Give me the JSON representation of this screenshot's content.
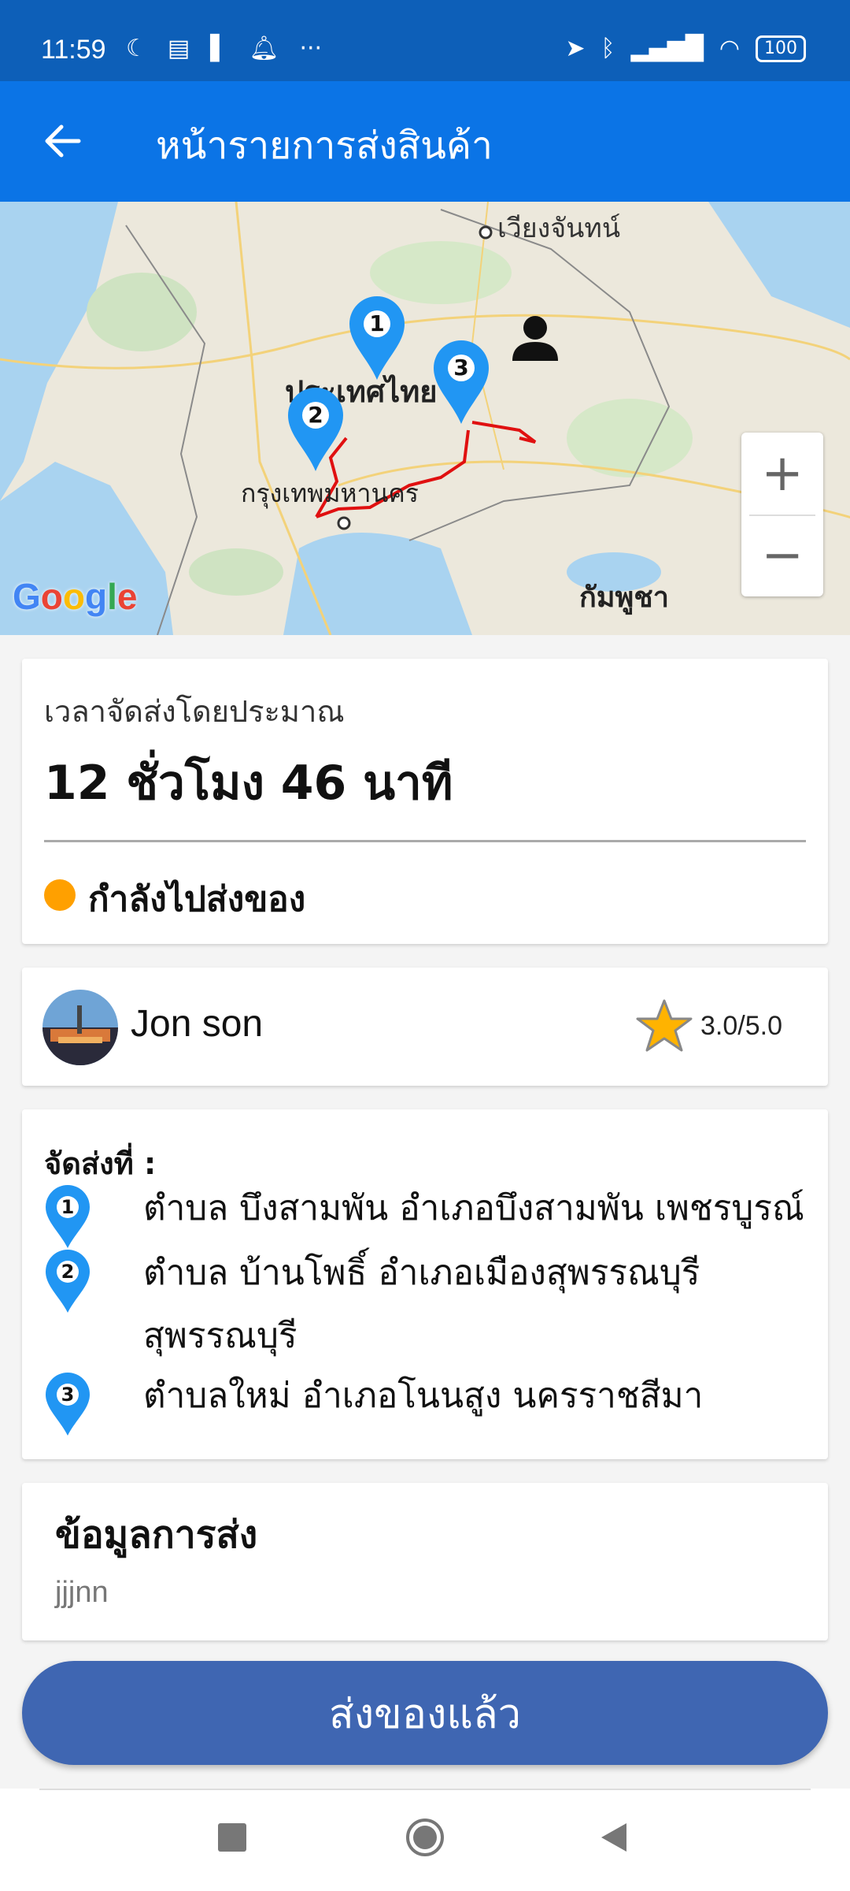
{
  "status_bar": {
    "time": "11:59",
    "icons": [
      "moon-icon",
      "notification-icon",
      "signal-bars-icon",
      "bell-icon",
      "more-dots-icon"
    ],
    "right_icons": [
      "location-arrow-icon",
      "bluetooth-icon",
      "signal-icon",
      "wifi-icon"
    ],
    "battery": "100"
  },
  "header": {
    "title": "หน้ารายการส่งสินค้า"
  },
  "map": {
    "labels": {
      "city_top": "เวียงจันทน์",
      "country": "ประเทศไทย",
      "capital": "กรุงเทพมหานคร",
      "cambodia": "กัมพูชา"
    },
    "markers": [
      "1",
      "2",
      "3"
    ],
    "zoom_in": "+",
    "zoom_out": "−",
    "google": [
      "G",
      "o",
      "o",
      "g",
      "l",
      "e"
    ]
  },
  "eta": {
    "label": "เวลาจัดส่งโดยประมาณ",
    "value": "12 ชั่วโมง 46 นาที",
    "status": "กำลังไปส่งของ",
    "status_color": "#ffa000"
  },
  "driver": {
    "name": "Jon son",
    "rating": "3.0/5.0"
  },
  "destinations": {
    "title": "จัดส่งที่ :",
    "items": [
      {
        "num": "1",
        "text": "ตำบล บึงสามพัน อำเภอบึงสามพัน เพชรบูรณ์"
      },
      {
        "num": "2",
        "text": "ตำบล บ้านโพธิ์ อำเภอเมืองสุพรรณบุรี สุพรรณบุรี"
      },
      {
        "num": "3",
        "text": "ตำบลใหม่ อำเภอโนนสูง นครราชสีมา"
      }
    ]
  },
  "info": {
    "title": "ข้อมูลการส่ง",
    "value": "jjjnn"
  },
  "action_button": {
    "label": "ส่งของแล้ว"
  },
  "colors": {
    "status_bar": "#0d5fb8",
    "app_bar": "#0b74e6",
    "button": "#3f66b2",
    "marker": "#2196f3",
    "route": "#e01010"
  }
}
